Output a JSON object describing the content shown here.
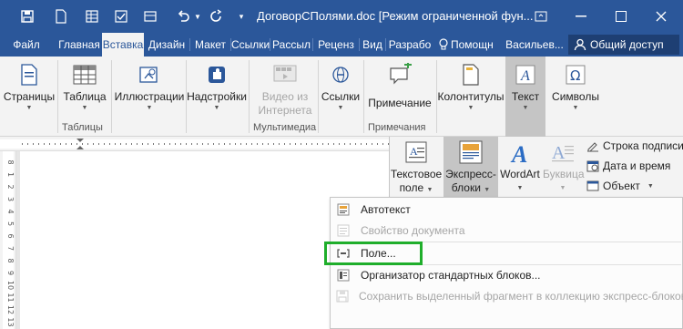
{
  "titlebar": {
    "title": "ДоговорСПолями.doc [Режим ограниченной фун...",
    "qat": {
      "save_icon": "save-icon",
      "undo_icon": "undo-icon",
      "redo_icon": "redo-icon"
    },
    "colors": {
      "bar": "#2b579a",
      "active_tab_bg": "#f3f3f3"
    }
  },
  "tabs": [
    {
      "label": "Файл"
    },
    {
      "label": "Главная"
    },
    {
      "label": "Вставка"
    },
    {
      "label": "Дизайн"
    },
    {
      "label": "Макет"
    },
    {
      "label": "Ссылки"
    },
    {
      "label": "Рассыл"
    },
    {
      "label": "Реценз"
    },
    {
      "label": "Вид"
    },
    {
      "label": "Разрабо"
    },
    {
      "label": "Помощн"
    },
    {
      "label": "Васильев..."
    }
  ],
  "share": {
    "label": "Общий доступ"
  },
  "ribbon": {
    "pages": "Страницы",
    "table": "Таблица",
    "illustrations": "Иллюстрации",
    "addins": "Надстройки",
    "video_line1": "Видео из",
    "video_line2": "Интернета",
    "links": "Ссылки",
    "comment": "Примечание",
    "header_footer": "Колонтитулы",
    "text": "Текст",
    "symbols": "Символы",
    "groups": {
      "tables": "Таблицы",
      "multimedia": "Мультимедиа",
      "comments": "Примечания"
    }
  },
  "text_panel": {
    "textbox_line1": "Текстовое",
    "textbox_line2": "поле",
    "quickparts_line1": "Экспресс-",
    "quickparts_line2": "блоки",
    "wordart": "WordArt",
    "dropcap": "Буквица",
    "signature_line": "Строка подписи",
    "date_time": "Дата и время",
    "object": "Объект"
  },
  "menu": {
    "items": [
      {
        "label": "Автотекст",
        "disabled": false
      },
      {
        "label": "Свойство документа",
        "disabled": true
      },
      {
        "label": "Поле...",
        "disabled": false
      },
      {
        "label": "Организатор стандартных блоков...",
        "disabled": false
      },
      {
        "label": "Сохранить выделенный фрагмент в коллекцию экспресс-блоков...",
        "disabled": true
      }
    ],
    "highlight_color": "#1fae2b"
  },
  "vruler_marks": [
    "8",
    "1",
    "2",
    "3",
    "4",
    "5",
    "6",
    "7",
    "8",
    "9",
    "10",
    "11",
    "12",
    "13"
  ]
}
